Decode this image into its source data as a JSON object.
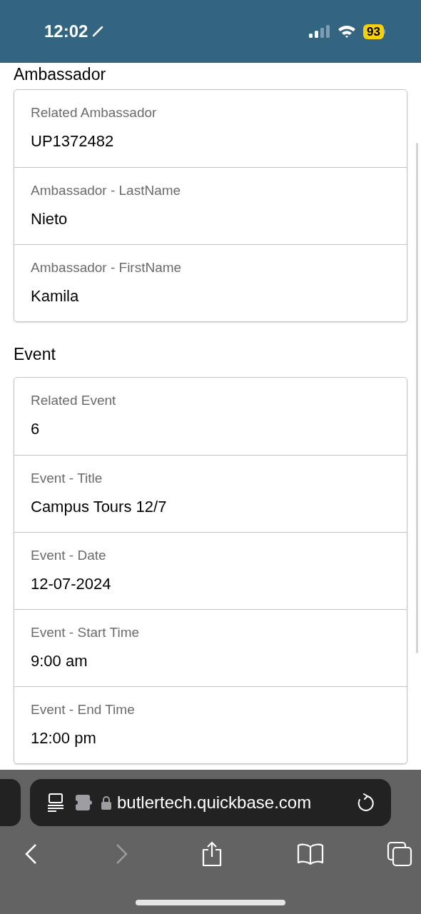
{
  "status_bar": {
    "time": "12:02",
    "battery": "93"
  },
  "sections": [
    {
      "heading": "Ambassador",
      "fields": [
        {
          "label": "Related Ambassador",
          "value": "UP1372482"
        },
        {
          "label": "Ambassador - LastName",
          "value": "Nieto"
        },
        {
          "label": "Ambassador - FirstName",
          "value": "Kamila"
        }
      ]
    },
    {
      "heading": "Event",
      "fields": [
        {
          "label": "Related Event",
          "value": "6"
        },
        {
          "label": "Event - Title",
          "value": "Campus Tours 12/7"
        },
        {
          "label": "Event - Date",
          "value": "12-07-2024"
        },
        {
          "label": "Event - Start Time",
          "value": "9:00 am"
        },
        {
          "label": "Event - End Time",
          "value": "12:00 pm"
        }
      ]
    }
  ],
  "browser": {
    "url": "butlertech.quickbase.com"
  }
}
